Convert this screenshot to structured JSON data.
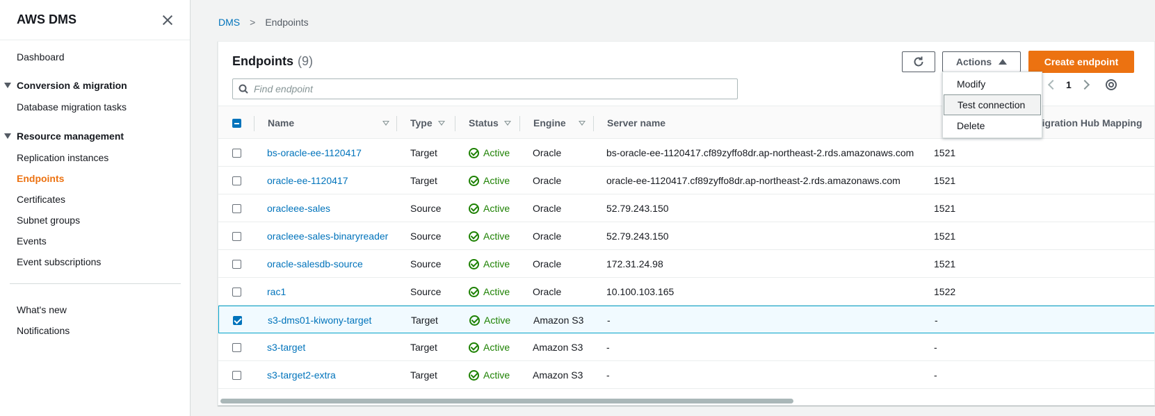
{
  "sidebar": {
    "title": "AWS DMS",
    "dashboard": "Dashboard",
    "section1": "Conversion & migration",
    "section1_items": [
      "Database migration tasks"
    ],
    "section2": "Resource management",
    "section2_items": [
      "Replication instances",
      "Endpoints",
      "Certificates",
      "Subnet groups",
      "Events",
      "Event subscriptions"
    ],
    "footer_items": [
      "What's new",
      "Notifications"
    ],
    "active_item": "Endpoints"
  },
  "breadcrumb": {
    "root": "DMS",
    "current": "Endpoints"
  },
  "panel": {
    "title": "Endpoints",
    "count": "(9)",
    "actions_label": "Actions",
    "create_label": "Create endpoint",
    "search_placeholder": "Find endpoint",
    "page": "1"
  },
  "actions_menu": [
    "Modify",
    "Test connection",
    "Delete"
  ],
  "table": {
    "columns": [
      "Name",
      "Type",
      "Status",
      "Engine",
      "Server name",
      "Migration Hub Mapping"
    ],
    "rows": [
      {
        "name": "bs-oracle-ee-1120417",
        "type": "Target",
        "status": "Active",
        "engine": "Oracle",
        "server": "bs-oracle-ee-1120417.cf89zyffo8dr.ap-northeast-2.rds.amazonaws.com",
        "port": "1521",
        "selected": false
      },
      {
        "name": "oracle-ee-1120417",
        "type": "Target",
        "status": "Active",
        "engine": "Oracle",
        "server": "oracle-ee-1120417.cf89zyffo8dr.ap-northeast-2.rds.amazonaws.com",
        "port": "1521",
        "selected": false
      },
      {
        "name": "oracleee-sales",
        "type": "Source",
        "status": "Active",
        "engine": "Oracle",
        "server": "52.79.243.150",
        "port": "1521",
        "selected": false
      },
      {
        "name": "oracleee-sales-binaryreader",
        "type": "Source",
        "status": "Active",
        "engine": "Oracle",
        "server": "52.79.243.150",
        "port": "1521",
        "selected": false
      },
      {
        "name": "oracle-salesdb-source",
        "type": "Source",
        "status": "Active",
        "engine": "Oracle",
        "server": "172.31.24.98",
        "port": "1521",
        "selected": false
      },
      {
        "name": "rac1",
        "type": "Source",
        "status": "Active",
        "engine": "Oracle",
        "server": "10.100.103.165",
        "port": "1522",
        "selected": false
      },
      {
        "name": "s3-dms01-kiwony-target",
        "type": "Target",
        "status": "Active",
        "engine": "Amazon S3",
        "server": "-",
        "port": "-",
        "selected": true
      },
      {
        "name": "s3-target",
        "type": "Target",
        "status": "Active",
        "engine": "Amazon S3",
        "server": "-",
        "port": "-",
        "selected": false
      },
      {
        "name": "s3-target2-extra",
        "type": "Target",
        "status": "Active",
        "engine": "Amazon S3",
        "server": "-",
        "port": "-",
        "selected": false
      }
    ]
  },
  "colors": {
    "accent": "#ec7211",
    "link": "#0073bb",
    "success": "#1d8102"
  }
}
